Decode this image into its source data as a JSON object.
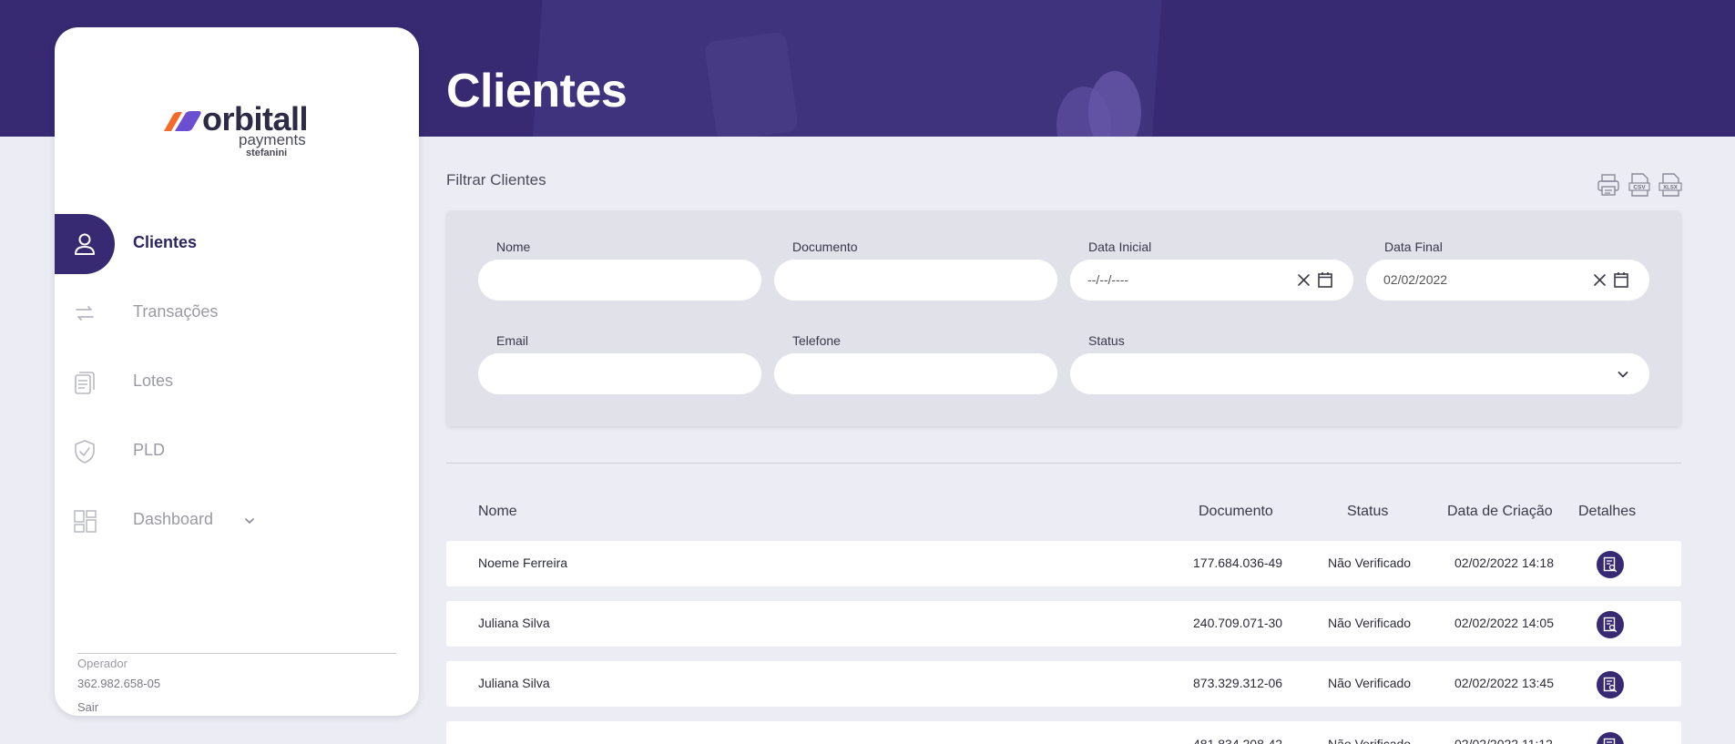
{
  "page": {
    "title": "Clientes"
  },
  "brand": {
    "name": "orbitall",
    "sub": "payments",
    "by": "stefanini"
  },
  "nav": {
    "items": [
      {
        "label": "Clientes",
        "icon": "user-icon",
        "active": true
      },
      {
        "label": "Transações",
        "icon": "transfer-icon",
        "active": false
      },
      {
        "label": "Lotes",
        "icon": "documents-icon",
        "active": false
      },
      {
        "label": "PLD",
        "icon": "shield-icon",
        "active": false
      },
      {
        "label": "Dashboard",
        "icon": "dashboard-icon",
        "active": false
      }
    ]
  },
  "operator": {
    "label": "Operador",
    "document": "362.982.658-05",
    "logout": "Sair"
  },
  "filters": {
    "title": "Filtrar Clientes",
    "nome": {
      "label": "Nome",
      "value": ""
    },
    "documento": {
      "label": "Documento",
      "value": ""
    },
    "data_inicial": {
      "label": "Data Inicial",
      "value": "--/--/----"
    },
    "data_final": {
      "label": "Data Final",
      "value": "02/02/2022"
    },
    "email": {
      "label": "Email",
      "value": ""
    },
    "telefone": {
      "label": "Telefone",
      "value": ""
    },
    "status": {
      "label": "Status",
      "value": ""
    }
  },
  "export": {
    "icons": [
      "print-icon",
      "csv-icon",
      "xlsx-icon"
    ]
  },
  "table": {
    "headers": {
      "nome": "Nome",
      "documento": "Documento",
      "status": "Status",
      "data": "Data de Criação",
      "detalhes": "Detalhes"
    },
    "rows": [
      {
        "nome": "Noeme Ferreira",
        "documento": "177.684.036-49",
        "status": "Não Verificado",
        "data": "02/02/2022 14:18"
      },
      {
        "nome": "Juliana Silva",
        "documento": "240.709.071-30",
        "status": "Não Verificado",
        "data": "02/02/2022 14:05"
      },
      {
        "nome": "Juliana Silva",
        "documento": "873.329.312-06",
        "status": "Não Verificado",
        "data": "02/02/2022 13:45"
      },
      {
        "nome": "",
        "documento": "481.834.208-42",
        "status": "Não Verificado",
        "data": "02/02/2022 11:12"
      }
    ]
  },
  "colors": {
    "primary": "#372a72",
    "background": "#ececf5",
    "panel": "#e1e1ea"
  }
}
